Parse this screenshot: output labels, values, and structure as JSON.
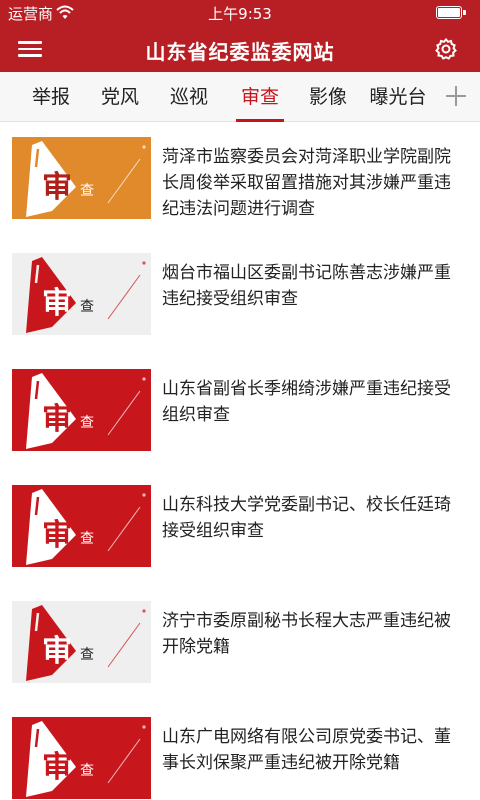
{
  "status_bar": {
    "carrier": "运营商",
    "time": "上午9:53",
    "battery_level": 1.0
  },
  "header": {
    "title": "山东省纪委监委网站",
    "menu_icon": "hamburger-icon",
    "settings_icon": "gear-icon"
  },
  "tabs": [
    {
      "label": "举报",
      "active": false
    },
    {
      "label": "党风",
      "active": false
    },
    {
      "label": "巡视",
      "active": false
    },
    {
      "label": "审查",
      "active": true
    },
    {
      "label": "影像",
      "active": false
    },
    {
      "label": "曝光台",
      "active": false
    }
  ],
  "thumbnail_text": {
    "big_char": "审",
    "small_char": "查"
  },
  "news": [
    {
      "title": "菏泽市监察委员会对菏泽职业学院副院长周俊举采取留置措施对其涉嫌严重违纪违法问题进行调查",
      "thumb_style": "orange"
    },
    {
      "title": "烟台市福山区委副书记陈善志涉嫌严重违纪接受组织审查",
      "thumb_style": "white"
    },
    {
      "title": "山东省副省长季缃绮涉嫌严重违纪接受组织审查",
      "thumb_style": "red"
    },
    {
      "title": "山东科技大学党委副书记、校长任廷琦接受组织审查",
      "thumb_style": "red"
    },
    {
      "title": "济宁市委原副秘书长程大志严重违纪被开除党籍",
      "thumb_style": "white"
    },
    {
      "title": "山东广电网络有限公司原党委书记、董事长刘保聚严重违纪被开除党籍",
      "thumb_style": "red"
    }
  ],
  "colors": {
    "brand_red": "#b81f24",
    "active_tab": "#c6141b",
    "thumb_orange": "#e08a2c",
    "thumb_red": "#c8161d"
  }
}
